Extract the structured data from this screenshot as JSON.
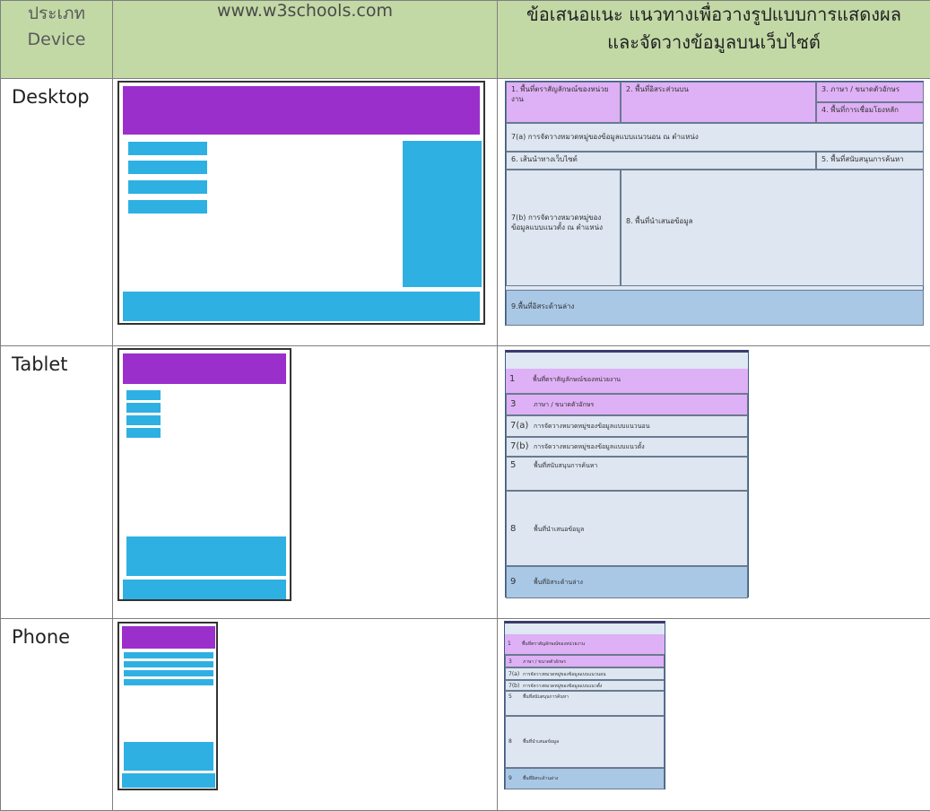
{
  "header": {
    "col1_line1": "ประเภท",
    "col1_line2": "Device",
    "col2": "www.w3schools.com",
    "col3_line1": "ข้อเสนอแนะ แนวทางเพื่อวางรูปแบบการแสดงผล",
    "col3_line2": "และจัดวางข้อมูลบนเว็บไซต์"
  },
  "rows": {
    "desktop": "Desktop",
    "tablet": "Tablet",
    "phone": "Phone"
  },
  "desktop_layout": {
    "a1": "1. พื้นที่ตราสัญลักษณ์ของหน่วยงาน",
    "a2": "2. พื้นที่อิสระส่วนบน",
    "a3": "3. ภาษา / ขนาดตัวอักษร",
    "a4": "4. พื้นที่การเชื่อมโยงหลัก",
    "a7a": "7(a) การจัดวางหมวดหมู่ของข้อมูลแบบแนวนอน ณ ตำแหน่ง",
    "a6": "6. เส้นนำทางเว็บไซต์",
    "a5": "5. พื้นที่สนับสนุนการค้นหา",
    "a7b": "7(b) การจัดวางหมวดหมู่ของข้อมูลแบบแนวตั้ง ณ ตำแหน่ง",
    "a8": "8. พื้นที่นำเสนอข้อมูล",
    "a9": "9.พื้นที่อิสระด้านล่าง"
  },
  "tablet_layout": [
    {
      "num": "1",
      "text": "พื้นที่ตราสัญลักษณ์ของหน่วยงาน"
    },
    {
      "num": "3",
      "text": "ภาษา / ขนาดตัวอักษร"
    },
    {
      "num": "7(a)",
      "text": "การจัดวางหมวดหมู่ของข้อมูลแบบแนวนอน"
    },
    {
      "num": "7(b)",
      "text": "การจัดวางหมวดหมู่ของข้อมูลแบบแนวตั้ง"
    },
    {
      "num": "5",
      "text": "พื้นที่สนับสนุนการค้นหา"
    },
    {
      "num": "8",
      "text": "พื้นที่นำเสนอข้อมูล"
    },
    {
      "num": "9",
      "text": "พื้นที่อิสระด้านล่าง"
    }
  ],
  "phone_layout": [
    {
      "num": "1",
      "text": "พื้นที่ตราสัญลักษณ์ของหน่วยงาน"
    },
    {
      "num": "3",
      "text": "ภาษา / ขนาดตัวอักษร"
    },
    {
      "num": "7(a)",
      "text": "การจัดวางหมวดหมู่ของข้อมูลแบบแนวนอน"
    },
    {
      "num": "7(b)",
      "text": "การจัดวางหมวดหมู่ของข้อมูลแบบแนวตั้ง"
    },
    {
      "num": "5",
      "text": "พื้นที่สนับสนุนการค้นหา"
    },
    {
      "num": "8",
      "text": "พื้นที่นำเสนอข้อมูล"
    },
    {
      "num": "9",
      "text": "พื้นที่อิสระด้านล่าง"
    }
  ],
  "colors": {
    "header_bg": "#c2d9a6",
    "purple": "#9b2fcc",
    "blue": "#2fb0e2",
    "layout_purple": "#deb0f5",
    "layout_blue": "#dde6f1",
    "layout_footer": "#a9c8e6"
  }
}
